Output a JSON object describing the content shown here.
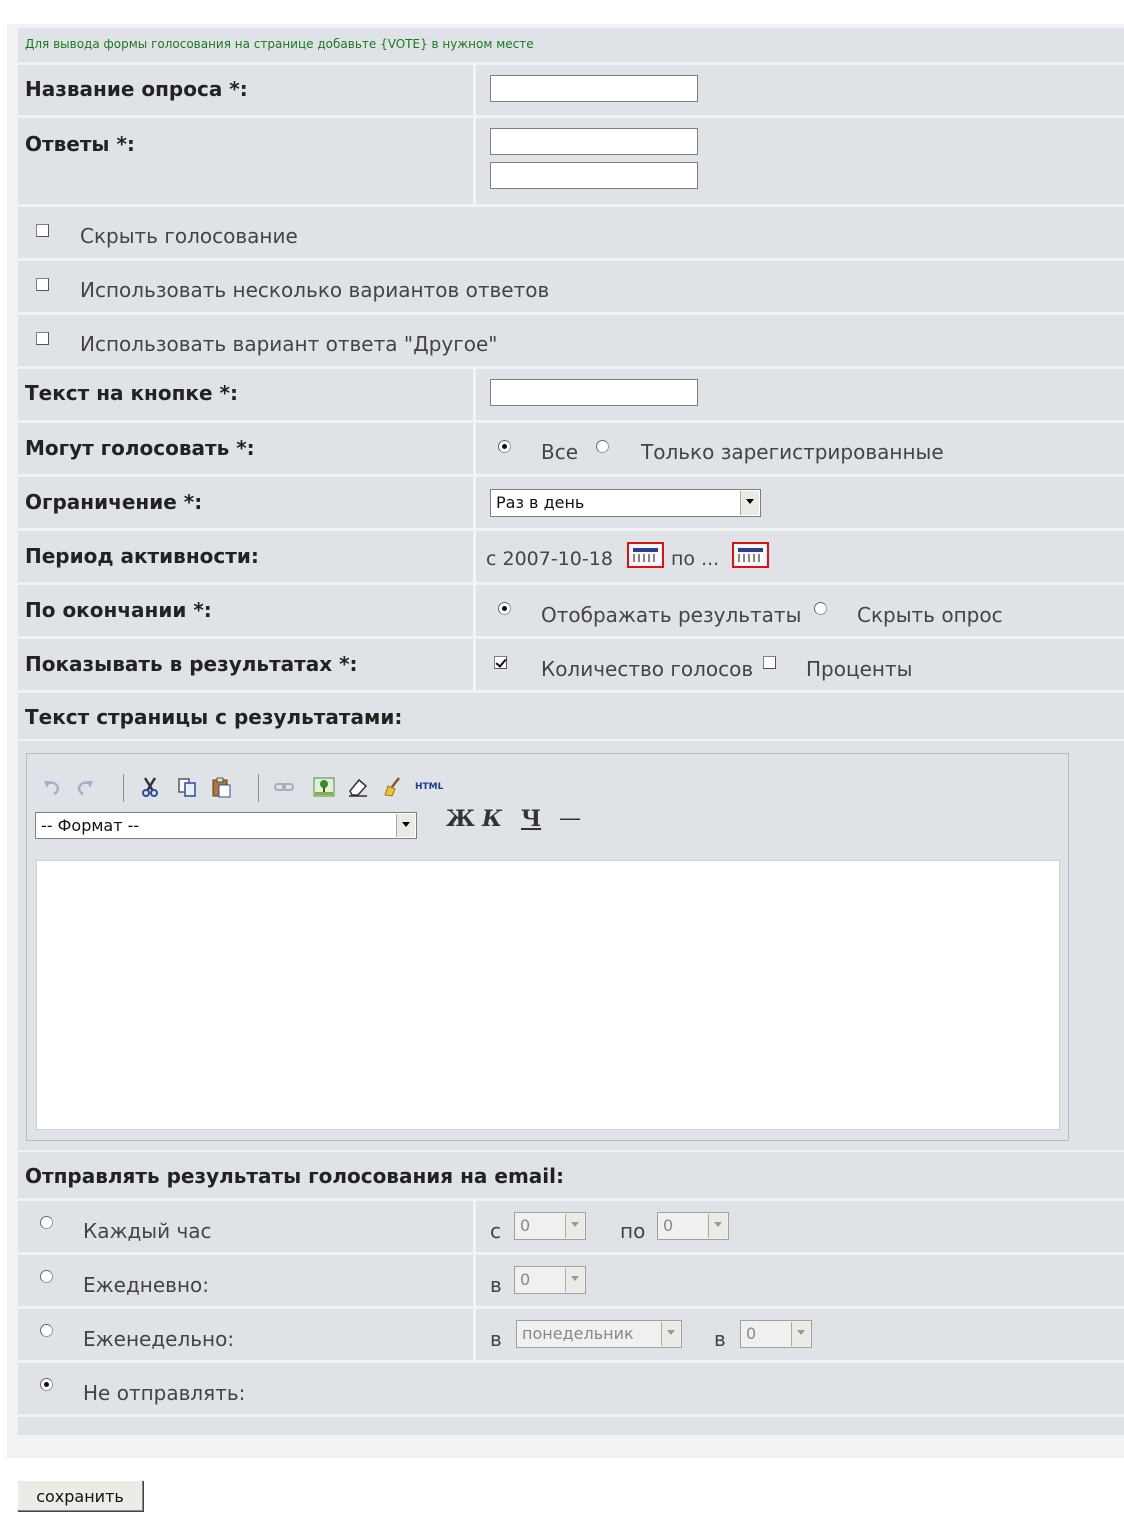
{
  "notice": "Для вывода формы голосования на странице добавьте {VOTE} в нужном месте",
  "title_label": "Название опроса *:",
  "answers_label": "Ответы *:",
  "hide_vote": "Скрыть голосование",
  "multiple_answers": "Использовать несколько вариантов ответов",
  "other_answer": "Использовать вариант ответа \"Другое\"",
  "button_text_label": "Текст на кнопке *:",
  "who_can_vote": {
    "label": "Могут голосовать *:",
    "options": [
      "Все",
      "Только зарегистрированные"
    ],
    "selected": 0
  },
  "limit": {
    "label": "Ограничение *:",
    "value": "Раз в день"
  },
  "period": {
    "label": "Период активности:",
    "from_text": "с 2007-10-18",
    "to_text": "по ..."
  },
  "after_end": {
    "label": "По окончании *:",
    "options": [
      "Отображать результаты",
      "Скрыть опрос"
    ],
    "selected": 0
  },
  "show_in_results": {
    "label": "Показывать в результатах *:",
    "options": [
      "Количество голосов",
      "Проценты"
    ],
    "checked": [
      true,
      false
    ]
  },
  "results_page_text_label": "Текст страницы с результатами:",
  "editor": {
    "format_placeholder": "-- Формат --",
    "html_label": "HTML",
    "bold": "Ж",
    "italic": "К",
    "underline": "Ч",
    "hr": "—",
    "toolbar_icons": [
      "undo-icon",
      "redo-icon",
      "cut-icon",
      "copy-icon",
      "paste-icon",
      "link-icon",
      "image-icon",
      "eraser-icon",
      "cleanup-icon",
      "html-icon"
    ]
  },
  "email_section_label": "Отправлять результаты голосования на email:",
  "email": {
    "hourly": {
      "label": "Каждый час",
      "from_prefix": "с",
      "from_value": "0",
      "to_prefix": "по",
      "to_value": "0"
    },
    "daily": {
      "label": "Ежедневно:",
      "prefix": "в",
      "value": "0"
    },
    "weekly": {
      "label": "Еженедельно:",
      "prefix": "в",
      "day_value": "понедельник",
      "prefix2": "в",
      "hour_value": "0"
    },
    "none": {
      "label": "Не отправлять:"
    },
    "selected": "none"
  },
  "save_label": "сохранить",
  "colors": {
    "row_bg": "#dfe3e8",
    "notice_text": "#1a7a1a",
    "calendar_border": "#dd1111"
  }
}
